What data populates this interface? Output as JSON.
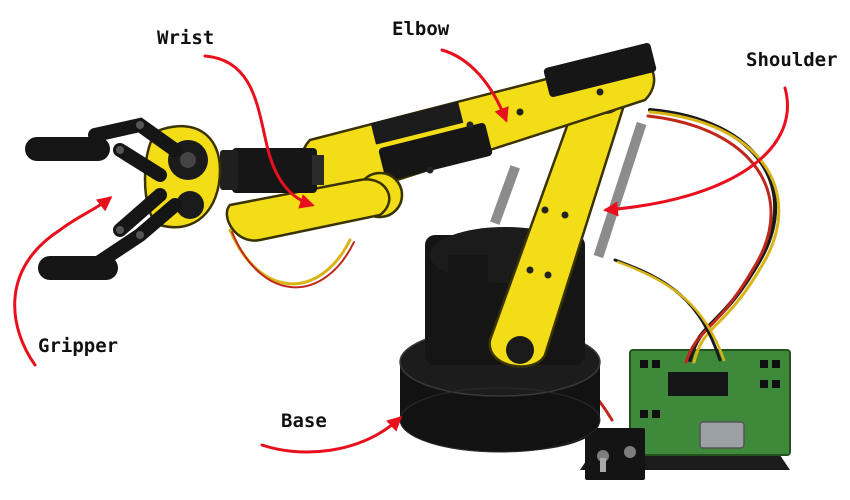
{
  "labels": {
    "wrist": "Wrist",
    "elbow": "Elbow",
    "shoulder": "Shoulder",
    "gripper": "Gripper",
    "base": "Base"
  },
  "colors": {
    "arm_yellow": "#f2dd16",
    "arm_outline": "#3a3300",
    "servo_black": "#161616",
    "base_black": "#121212",
    "pcb_green": "#3f8a3a",
    "arrow_red": "#e8101c",
    "wire_red": "#c0281c",
    "wire_yellow": "#d8b417",
    "wire_black": "#1a1a1a"
  },
  "icons": {
    "gripper": "robot-gripper-icon",
    "servo": "servo-motor-icon",
    "base": "rotating-base-icon",
    "controller": "pcb-controller-icon"
  }
}
